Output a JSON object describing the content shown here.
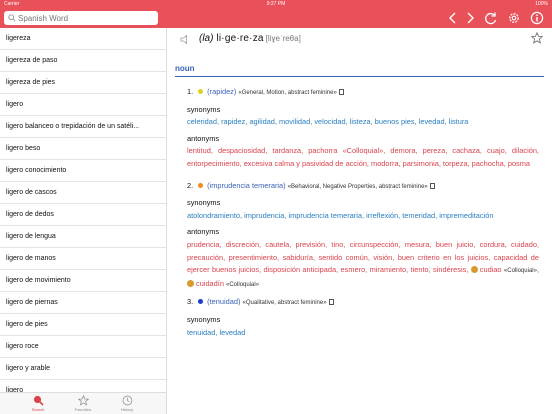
{
  "status": {
    "carrier": "Carrier",
    "time": "9:27 PM",
    "battery": "100%"
  },
  "search": {
    "placeholder": "Spanish Word"
  },
  "list": [
    "ligereza",
    "ligereza de paso",
    "ligereza de pies",
    "ligero",
    "ligero balanceo o trepidación de un satéli...",
    "ligero beso",
    "ligero conocimiento",
    "ligero de cascos",
    "ligero de dedos",
    "ligero de lengua",
    "ligero de manos",
    "ligero de movimiento",
    "ligero de piernas",
    "ligero de pies",
    "ligero roce",
    "ligero y arable",
    "ligero"
  ],
  "tabs": {
    "search": "Search",
    "favorites": "Favorites",
    "history": "History"
  },
  "colors": {
    "accent": "#e8505a",
    "link": "#2a7fbf",
    "antonym": "#d9434c"
  },
  "entry": {
    "article": "(la)",
    "word": "li·ge·re·za",
    "ipa": "[liɣeˈreθa]",
    "pos": "noun",
    "synonyms_label": "synonyms",
    "antonyms_label": "antonyms",
    "senses": [
      {
        "num": "1.",
        "dot_color": "#e0d020",
        "gloss": "(rapidez)",
        "meta": "«General, Motion, abstract feminine»",
        "synonyms": "celeridad, rapidez, agilidad, movilidad, velocidad, listeza, buenos pies, levedad, listura",
        "antonyms": "lentitud, despaciosidad, tardanza, pachorra «Colloquial», demora, pereza, cachaza, cuajo, dilación, entorpecimiento, excesiva calma y pasividad de acción, modorra, parsimonia, torpeza, pachocha, posma"
      },
      {
        "num": "2.",
        "dot_color": "#f08a1a",
        "gloss": "(imprudencia temeraria)",
        "meta": "«Behavioral, Negative Properties, abstract feminine»",
        "synonyms": "atolondramiento, imprudencia, imprudencia temeraria, irreflexión, temeridad, impremeditación",
        "antonyms": "prudencia, discreción, cautela, previsión, tino, circunspección, mesura, buen juicio, cordura, cuidado, precaución, presentimiento, sabiduría, sentido común, visión, buen criterio en los juicios, capacidad de ejercer buenos juicios, disposición anticipada, esmero, miramiento, tiento, sindéresis,",
        "antonyms_extra1": "cudiao",
        "antonyms_extra1_note": "«Colloquial»",
        "antonyms_extra2": "cuidadín",
        "antonyms_extra2_note": "«Colloquial»"
      },
      {
        "num": "3.",
        "dot_color": "#1a3ad0",
        "gloss": "(tenuidad)",
        "meta": "«Qualitative, abstract feminine»",
        "synonyms": "tenuidad, levedad"
      }
    ]
  }
}
